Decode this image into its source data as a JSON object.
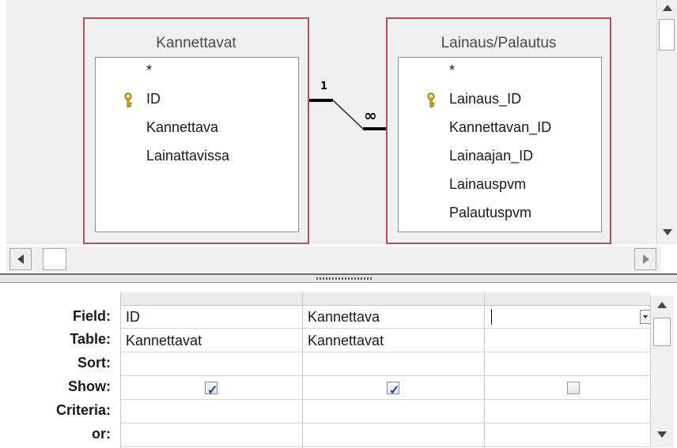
{
  "tables": [
    {
      "title": "Kannettavat",
      "fields": [
        {
          "name": "*",
          "key": false
        },
        {
          "name": "ID",
          "key": true
        },
        {
          "name": "Kannettava",
          "key": false
        },
        {
          "name": "Lainattavissa",
          "key": false
        }
      ]
    },
    {
      "title": "Lainaus/Palautus",
      "fields": [
        {
          "name": "*",
          "key": false
        },
        {
          "name": "Lainaus_ID",
          "key": true
        },
        {
          "name": "Kannettavan_ID",
          "key": false
        },
        {
          "name": "Lainaajan_ID",
          "key": false
        },
        {
          "name": "Lainauspvm",
          "key": false
        },
        {
          "name": "Palautuspvm",
          "key": false
        }
      ]
    }
  ],
  "relationship": {
    "one_label": "1",
    "many_label": "∞"
  },
  "colors": {
    "table_border": "#b85058",
    "pane_background": "#f0f0f0",
    "checkbox_mark": "#2c4a7a"
  },
  "grid": {
    "row_labels": [
      "Field:",
      "Table:",
      "Sort:",
      "Show:",
      "Criteria:",
      "or:"
    ],
    "columns": [
      {
        "field": "ID",
        "table": "Kannettavat",
        "sort": "",
        "show": true,
        "criteria": "",
        "or": ""
      },
      {
        "field": "Kannettava",
        "table": "Kannettavat",
        "sort": "",
        "show": true,
        "criteria": "",
        "or": ""
      },
      {
        "field": "",
        "table": "",
        "sort": "",
        "show": false,
        "criteria": "",
        "or": ""
      }
    ],
    "show_checked_glyph": "✓"
  }
}
